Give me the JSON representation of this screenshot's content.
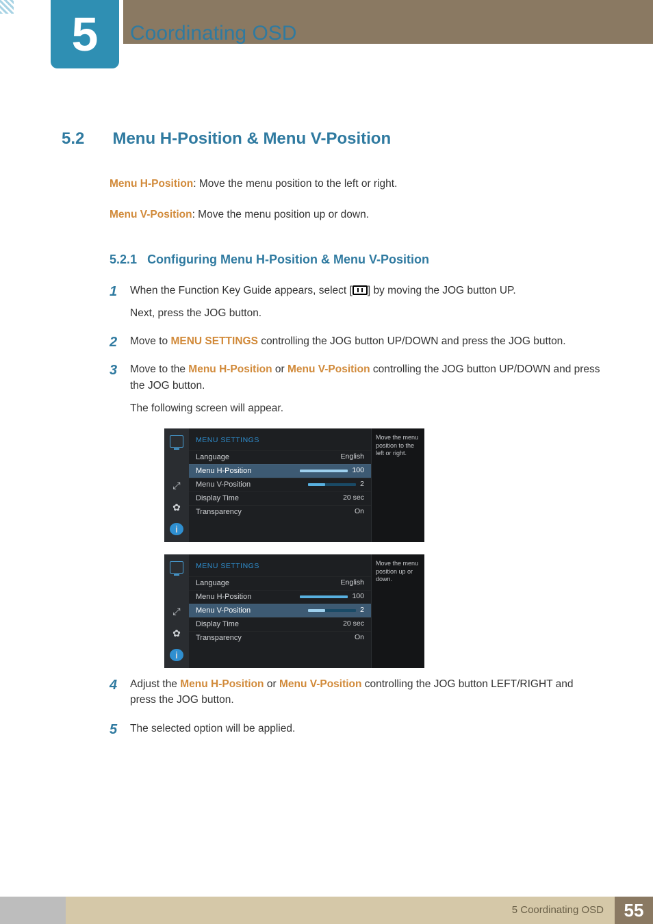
{
  "chapter": {
    "number": "5",
    "title": "Coordinating OSD"
  },
  "section": {
    "number": "5.2",
    "title": "Menu H-Position & Menu V-Position"
  },
  "defs": {
    "h_label": "Menu H-Position",
    "h_text": ": Move the menu position to the left or right.",
    "v_label": "Menu V-Position",
    "v_text": ": Move the menu position up or down."
  },
  "subsection": {
    "number": "5.2.1",
    "title": "Configuring Menu H-Position & Menu V-Position"
  },
  "steps": {
    "s1a": "When the Function Key Guide appears, select [",
    "s1b": "] by moving the JOG button UP.",
    "s1_next": "Next, press the JOG button.",
    "s2_a": "Move to ",
    "s2_term": "MENU SETTINGS",
    "s2_b": " controlling the JOG button UP/DOWN and press the JOG button.",
    "s3_a": "Move to the ",
    "s3_term1": "Menu H-Position",
    "s3_mid": " or ",
    "s3_term2": "Menu V-Position",
    "s3_b": " controlling the JOG button UP/DOWN and press the JOG button.",
    "s3_next": "The following screen will appear.",
    "s4_a": "Adjust the ",
    "s4_term1": "Menu H-Position",
    "s4_mid": " or ",
    "s4_term2": "Menu V-Position",
    "s4_b": " controlling the JOG button LEFT/RIGHT and press the JOG button.",
    "s5": "The selected option will be applied."
  },
  "osd_labels": {
    "heading": "MENU SETTINGS",
    "language": "Language",
    "h_pos": "Menu H-Position",
    "v_pos": "Menu V-Position",
    "display_time": "Display Time",
    "transparency": "Transparency"
  },
  "osd_values": {
    "language": "English",
    "h_pos": "100",
    "v_pos": "2",
    "display_time": "20 sec",
    "transparency": "On"
  },
  "tips": {
    "tip1": "Move the menu position to the left or right.",
    "tip2": "Move the menu position up or down."
  },
  "footer": {
    "chapter_label": "5 Coordinating OSD",
    "page": "55"
  }
}
